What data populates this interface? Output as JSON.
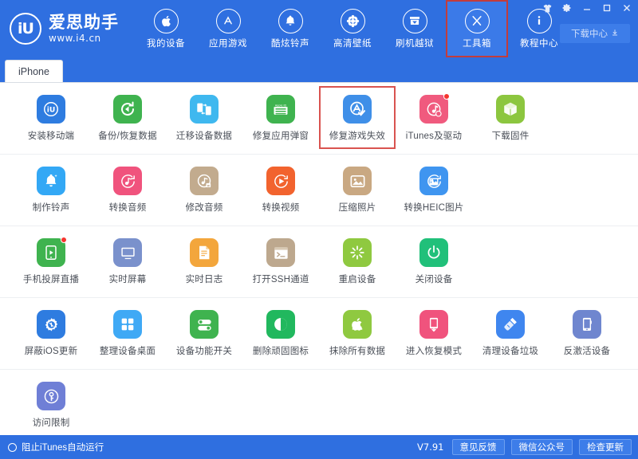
{
  "window": {
    "brand_initials": "iU",
    "brand_name": "爱思助手",
    "brand_url": "www.i4.cn",
    "controls": [
      {
        "name": "skin",
        "glyph": "shirt-icon"
      },
      {
        "name": "settings",
        "glyph": "gear-icon"
      },
      {
        "name": "minimize",
        "glyph": "minimize-icon"
      },
      {
        "name": "maximize",
        "glyph": "maximize-icon"
      },
      {
        "name": "close",
        "glyph": "close-icon"
      }
    ],
    "download_center_label": "下载中心"
  },
  "nav": {
    "items": [
      {
        "label": "我的设备",
        "icon": "apple-icon",
        "active": false
      },
      {
        "label": "应用游戏",
        "icon": "appstore-icon",
        "active": false
      },
      {
        "label": "酷炫铃声",
        "icon": "bell-icon",
        "active": false
      },
      {
        "label": "高清壁纸",
        "icon": "flower-icon",
        "active": false
      },
      {
        "label": "刷机越狱",
        "icon": "box-arrow-icon",
        "active": false
      },
      {
        "label": "工具箱",
        "icon": "tools-icon",
        "active": true
      },
      {
        "label": "教程中心",
        "icon": "info-icon",
        "active": false
      }
    ]
  },
  "tabs": [
    {
      "label": "iPhone",
      "active": true
    }
  ],
  "toolbox": {
    "rows": [
      [
        {
          "label": "安装移动端",
          "icon": "i4-app-icon",
          "color": "#2e7ce0",
          "badge": false
        },
        {
          "label": "备份/恢复数据",
          "icon": "backup-restore-icon",
          "color": "#3fb34f",
          "badge": false
        },
        {
          "label": "迁移设备数据",
          "icon": "migrate-devices-icon",
          "color": "#3fb8ef",
          "badge": false
        },
        {
          "label": "修复应用弹窗",
          "icon": "appleid-card-icon",
          "color": "#3fb34f",
          "badge": false
        },
        {
          "label": "修复游戏失效",
          "icon": "appstore-fix-icon",
          "color": "#3f8fe8",
          "badge": false,
          "highlight": true
        },
        {
          "label": "iTunes及驱动",
          "icon": "itunes-driver-icon",
          "color": "#f05a7e",
          "badge": true
        },
        {
          "label": "下载固件",
          "icon": "firmware-box-icon",
          "color": "#8bc council",
          "badge": false
        }
      ],
      [
        {
          "label": "制作铃声",
          "icon": "make-ringtone-icon",
          "color": "#33a8f5",
          "badge": false
        },
        {
          "label": "转换音频",
          "icon": "convert-audio-icon",
          "color": "#f0537d",
          "badge": false
        },
        {
          "label": "修改音频",
          "icon": "edit-audio-icon",
          "color": "#c2ab8e",
          "badge": false
        },
        {
          "label": "转换视频",
          "icon": "convert-video-icon",
          "color": "#f2632e",
          "badge": false
        },
        {
          "label": "压缩照片",
          "icon": "compress-photo-icon",
          "color": "#c9a882",
          "badge": false
        },
        {
          "label": "转换HEIC图片",
          "icon": "heic-convert-icon",
          "color": "#3f95f0",
          "badge": false
        }
      ],
      [
        {
          "label": "手机投屏直播",
          "icon": "screen-cast-icon",
          "color": "#3fb34f",
          "badge": true
        },
        {
          "label": "实时屏幕",
          "icon": "live-screen-icon",
          "color": "#7a91cc",
          "badge": false
        },
        {
          "label": "实时日志",
          "icon": "live-log-icon",
          "color": "#f3a63c",
          "badge": false
        },
        {
          "label": "打开SSH通道",
          "icon": "ssh-terminal-icon",
          "color": "#bda88e",
          "badge": false
        },
        {
          "label": "重启设备",
          "icon": "reboot-icon",
          "color": "#8fc940",
          "badge": false
        },
        {
          "label": "关闭设备",
          "icon": "power-off-icon",
          "color": "#21c07a",
          "badge": false
        }
      ],
      [
        {
          "label": "屏蔽iOS更新",
          "icon": "block-ios-update-icon",
          "color": "#2e7ce0",
          "badge": false
        },
        {
          "label": "整理设备桌面",
          "icon": "organize-desktop-icon",
          "color": "#3fa9f5",
          "badge": false
        },
        {
          "label": "设备功能开关",
          "icon": "feature-toggle-icon",
          "color": "#3fb34f",
          "badge": false
        },
        {
          "label": "删除顽固图标",
          "icon": "delete-icon-icon",
          "color": "#21b85e",
          "badge": false
        },
        {
          "label": "抹除所有数据",
          "icon": "erase-all-icon",
          "color": "#8fc940",
          "badge": false
        },
        {
          "label": "进入恢复模式",
          "icon": "recovery-mode-icon",
          "color": "#f0537d",
          "badge": false
        },
        {
          "label": "清理设备垃圾",
          "icon": "clean-junk-icon",
          "color": "#3f86ef",
          "badge": false
        },
        {
          "label": "反激活设备",
          "icon": "deactivate-icon",
          "color": "#6f86cf",
          "badge": false
        }
      ],
      [
        {
          "label": "访问限制",
          "icon": "access-restriction-icon",
          "color": "#6f7fd6",
          "badge": false
        }
      ]
    ]
  },
  "statusbar": {
    "block_itunes_label": "阻止iTunes自动运行",
    "version": "V7.91",
    "buttons": [
      {
        "label": "意见反馈"
      },
      {
        "label": "微信公众号"
      },
      {
        "label": "检查更新"
      }
    ]
  }
}
